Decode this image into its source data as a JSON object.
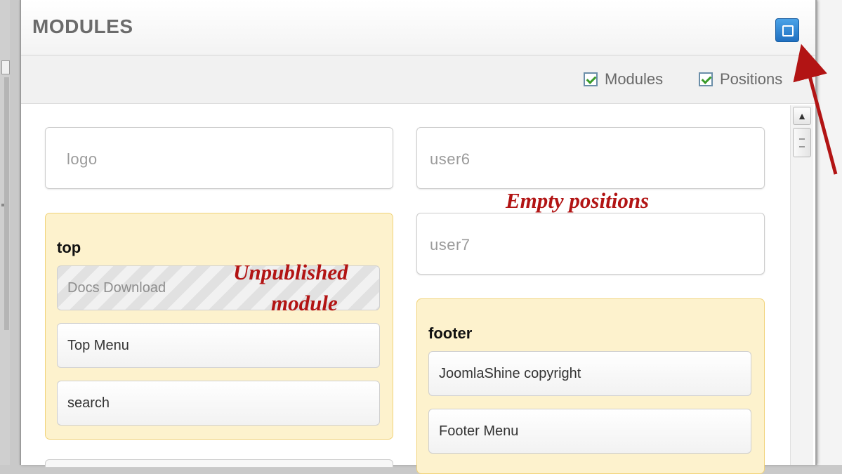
{
  "panel": {
    "title": "MODULES"
  },
  "toolbar": {
    "checkboxes": [
      {
        "label": "Modules",
        "checked": true
      },
      {
        "label": "Positions",
        "checked": true
      }
    ]
  },
  "positions": {
    "logo": {
      "name": "logo"
    },
    "user6": {
      "name": "user6"
    },
    "user7": {
      "name": "user7"
    },
    "top": {
      "name": "top",
      "modules": [
        {
          "title": "Docs Download",
          "published": false
        },
        {
          "title": "Top Menu",
          "published": true
        },
        {
          "title": "search",
          "published": true
        }
      ]
    },
    "footer": {
      "name": "footer",
      "modules": [
        {
          "title": "JoomlaShine copyright",
          "published": true
        },
        {
          "title": "Footer Menu",
          "published": true
        }
      ]
    }
  },
  "annotations": {
    "empty_positions": "Empty positions",
    "unpublished_line1": "Unpublished",
    "unpublished_line2": "module"
  },
  "colors": {
    "annotation": "#b21414",
    "maximize_button": "#1f6fc0",
    "group_background": "#fdf2cd"
  },
  "icons": {
    "maximize": "maximize-square-icon",
    "scroll_up": "chevron-up-icon"
  }
}
